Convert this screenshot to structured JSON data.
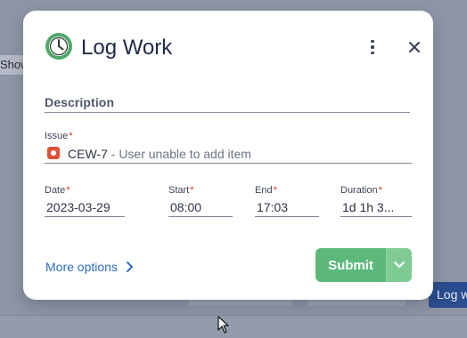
{
  "background": {
    "left_text": "Show",
    "right_button": "Log w"
  },
  "modal": {
    "title": "Log Work",
    "icons": {
      "header": "clock-icon",
      "menu": "kebab-menu-icon",
      "close": "close-icon"
    },
    "description": {
      "label": "Description"
    },
    "issue": {
      "label": "Issue",
      "required_mark": "*",
      "key": "CEW-7",
      "separator": " - ",
      "summary": "User unable to add item",
      "type_icon": "bug-icon"
    },
    "date": {
      "label": "Date",
      "required_mark": "*",
      "value": "2023-03-29"
    },
    "start": {
      "label": "Start",
      "required_mark": "*",
      "value": "08:00"
    },
    "end": {
      "label": "End",
      "required_mark": "*",
      "value": "17:03"
    },
    "duration": {
      "label": "Duration",
      "required_mark": "*",
      "value": "1d 1h 3..."
    },
    "more_options": "More options",
    "submit_label": "Submit"
  },
  "colors": {
    "accent_green": "#5cb97a",
    "link_blue": "#2f6bc4",
    "required_red": "#de350b",
    "title_navy": "#1f2a44"
  }
}
